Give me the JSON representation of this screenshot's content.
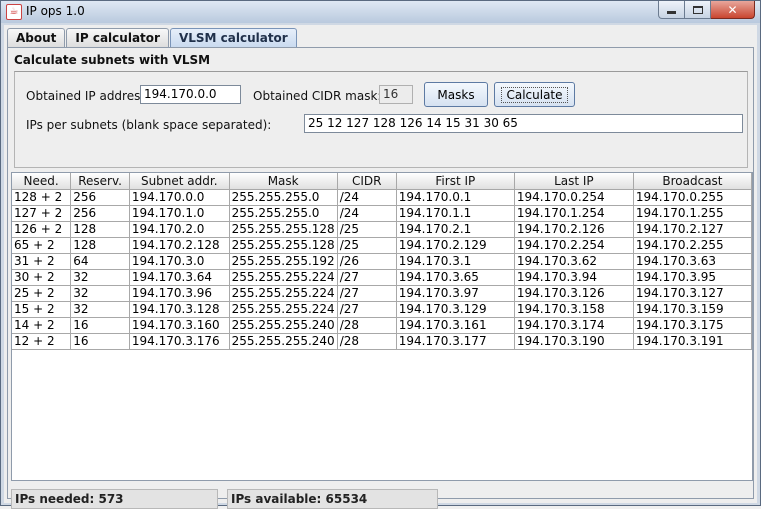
{
  "window": {
    "title": "IP ops 1.0",
    "close_glyph": "✕"
  },
  "tabs": [
    {
      "label": "About",
      "active": false
    },
    {
      "label": "IP calculator",
      "active": false
    },
    {
      "label": "VLSM calculator",
      "active": true
    }
  ],
  "form": {
    "group_title": "Calculate subnets with VLSM",
    "ip_label": "Obtained IP address:",
    "ip_value": "194.170.0.0",
    "cidr_label": "Obtained CIDR mask:",
    "cidr_value": "16",
    "masks_button": "Masks",
    "calculate_button": "Calculate",
    "ips_label": "IPs per subnets (blank space separated):",
    "ips_value": "25 12 127 128 126 14 15 31 30 65"
  },
  "table": {
    "columns": [
      "Need.",
      "Reserv.",
      "Subnet addr.",
      "Mask",
      "CIDR",
      "First IP",
      "Last IP",
      "Broadcast"
    ],
    "rows": [
      [
        "128 + 2",
        "256",
        "194.170.0.0",
        "255.255.255.0",
        "/24",
        "194.170.0.1",
        "194.170.0.254",
        "194.170.0.255"
      ],
      [
        "127 + 2",
        "256",
        "194.170.1.0",
        "255.255.255.0",
        "/24",
        "194.170.1.1",
        "194.170.1.254",
        "194.170.1.255"
      ],
      [
        "126 + 2",
        "128",
        "194.170.2.0",
        "255.255.255.128",
        "/25",
        "194.170.2.1",
        "194.170.2.126",
        "194.170.2.127"
      ],
      [
        "65 + 2",
        "128",
        "194.170.2.128",
        "255.255.255.128",
        "/25",
        "194.170.2.129",
        "194.170.2.254",
        "194.170.2.255"
      ],
      [
        "31 + 2",
        "64",
        "194.170.3.0",
        "255.255.255.192",
        "/26",
        "194.170.3.1",
        "194.170.3.62",
        "194.170.3.63"
      ],
      [
        "30 + 2",
        "32",
        "194.170.3.64",
        "255.255.255.224",
        "/27",
        "194.170.3.65",
        "194.170.3.94",
        "194.170.3.95"
      ],
      [
        "25 + 2",
        "32",
        "194.170.3.96",
        "255.255.255.224",
        "/27",
        "194.170.3.97",
        "194.170.3.126",
        "194.170.3.127"
      ],
      [
        "15 + 2",
        "32",
        "194.170.3.128",
        "255.255.255.224",
        "/27",
        "194.170.3.129",
        "194.170.3.158",
        "194.170.3.159"
      ],
      [
        "14 + 2",
        "16",
        "194.170.3.160",
        "255.255.255.240",
        "/28",
        "194.170.3.161",
        "194.170.3.174",
        "194.170.3.175"
      ],
      [
        "12 + 2",
        "16",
        "194.170.3.176",
        "255.255.255.240",
        "/28",
        "194.170.3.177",
        "194.170.3.190",
        "194.170.3.191"
      ]
    ]
  },
  "status": {
    "needed": "IPs needed: 573",
    "available": "IPs available: 65534"
  },
  "icons": {
    "app": "java-cup-icon",
    "minimize": "minimize-icon",
    "maximize": "maximize-icon",
    "close": "close-icon"
  }
}
